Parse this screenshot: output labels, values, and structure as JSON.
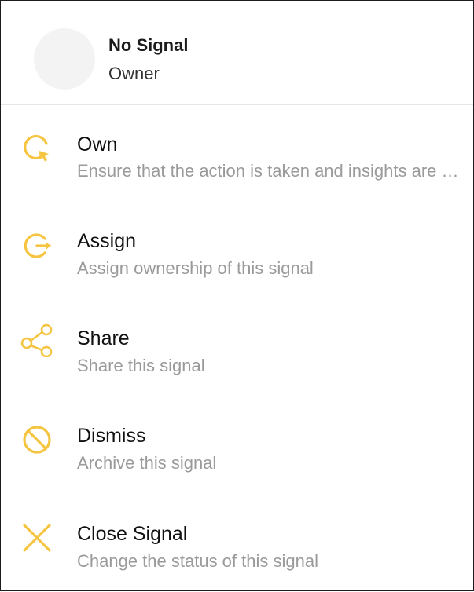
{
  "header": {
    "title": "No Signal",
    "subtitle": "Owner"
  },
  "accent_color": "#F5C542",
  "menu": [
    {
      "label": "Own",
      "description": "Ensure that the action is taken and insights are shared",
      "icon": "own-icon"
    },
    {
      "label": "Assign",
      "description": "Assign ownership of this signal",
      "icon": "assign-icon"
    },
    {
      "label": "Share",
      "description": "Share this signal",
      "icon": "share-icon"
    },
    {
      "label": "Dismiss",
      "description": "Archive this signal",
      "icon": "dismiss-icon"
    },
    {
      "label": "Close Signal",
      "description": "Change the status of this signal",
      "icon": "close-icon"
    }
  ]
}
